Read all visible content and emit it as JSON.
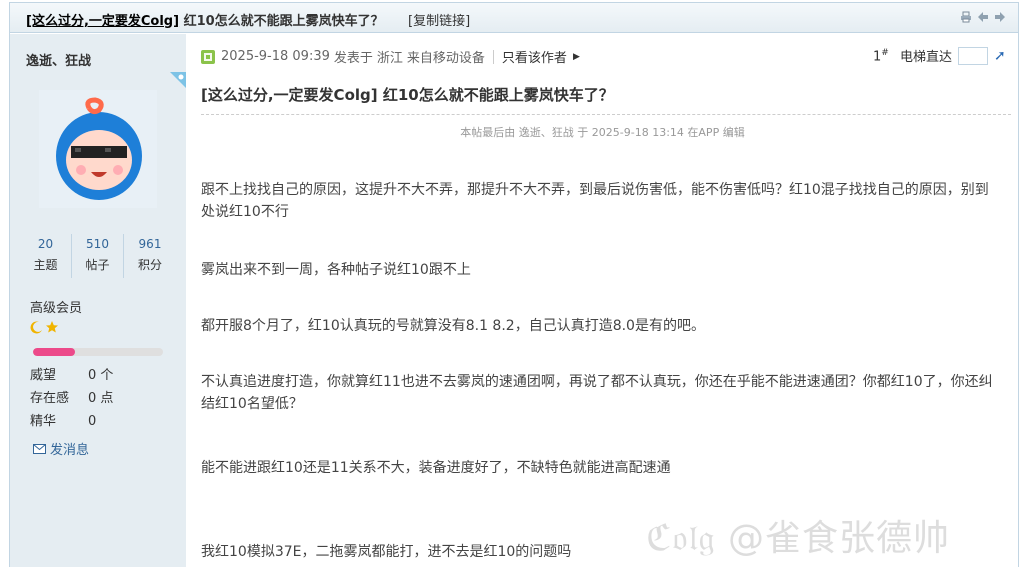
{
  "titlebar": {
    "title_prefix": "[这么过分,一定要发Colg]",
    "title_rest": " 红10怎么就不能跟上雾岚快车了？",
    "copy_link": "[复制链接]"
  },
  "sidebar": {
    "author": "逸逝、狂战",
    "stats": [
      {
        "value": "20",
        "label": "主题"
      },
      {
        "value": "510",
        "label": "帖子"
      },
      {
        "value": "961",
        "label": "积分"
      }
    ],
    "user_group": "高级会员",
    "progress_fraction": 0.32,
    "attributes": [
      {
        "key": "威望",
        "value": "0 个"
      },
      {
        "key": "存在感",
        "value": "0 点"
      },
      {
        "key": "精华",
        "value": "0"
      }
    ],
    "send_message": "发消息",
    "colors": {
      "bg": "#e5edf2",
      "link": "#336699",
      "progress": "#ec4a8a"
    }
  },
  "post": {
    "meta": {
      "datetime": "2025-9-18 09:39",
      "posted_in": "发表于",
      "location": "浙江",
      "device": "来自移动设备",
      "only_author": "只看该作者"
    },
    "floor_num": "1",
    "floor_mark": "#",
    "jump_label": "电梯直达",
    "title": "[这么过分,一定要发Colg] 红10怎么就不能跟上雾岚快车了？",
    "edited_note": "本帖最后由 逸逝、狂战 于 2025-9-18 13:14 在APP 编辑",
    "paragraphs": [
      "跟不上找找自己的原因，这提升不大不弄，那提升不大不弄，到最后说伤害低，能不伤害低吗？红10混子找找自己的原因，别到处说红10不行",
      "雾岚出来不到一周，各种帖子说红10跟不上",
      "都开服8个月了，红10认真玩的号就算没有8.1 8.2，自己认真打造8.0是有的吧。",
      "不认真追进度打造，你就算红11也进不去雾岚的速通团啊，再说了都不认真玩，你还在乎能不能进速通团？你都红10了，你还纠结红10名望低？",
      "能不能进跟红10还是11关系不大，装备进度好了，不缺特色就能进高配速通",
      "我红10模拟37E，二拖雾岚都能打，进不去是红10的问题吗"
    ]
  },
  "watermark": "ℭ𝔬𝔩𝔤 @雀食张德帅"
}
